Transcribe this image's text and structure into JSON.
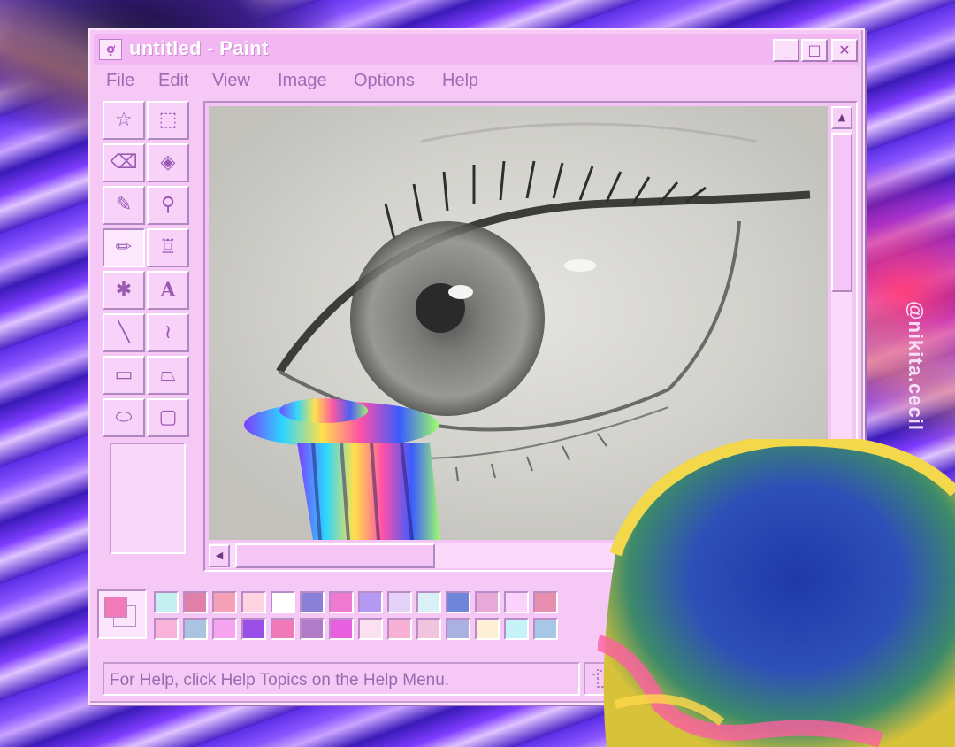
{
  "window": {
    "title": "untitled - Paint",
    "app_icon_glyph": "ợ",
    "controls": {
      "minimize": "_",
      "maximize": "□",
      "close": "✕"
    }
  },
  "menu": {
    "items": [
      {
        "label": "File"
      },
      {
        "label": "Edit"
      },
      {
        "label": "View"
      },
      {
        "label": "Image"
      },
      {
        "label": "Options"
      },
      {
        "label": "Help"
      }
    ]
  },
  "tools": [
    {
      "name": "free-form-select-icon",
      "glyph": "☆"
    },
    {
      "name": "rect-select-icon",
      "glyph": "⬚"
    },
    {
      "name": "eraser-icon",
      "glyph": "⌫"
    },
    {
      "name": "fill-bucket-icon",
      "glyph": "◈"
    },
    {
      "name": "color-picker-icon",
      "glyph": "✎"
    },
    {
      "name": "magnifier-icon",
      "glyph": "⚲"
    },
    {
      "name": "pencil-icon",
      "glyph": "✏"
    },
    {
      "name": "brush-icon",
      "glyph": "♖"
    },
    {
      "name": "airbrush-icon",
      "glyph": "✱"
    },
    {
      "name": "text-icon",
      "glyph": "A"
    },
    {
      "name": "line-icon",
      "glyph": "╲"
    },
    {
      "name": "curve-icon",
      "glyph": "≀"
    },
    {
      "name": "rectangle-icon",
      "glyph": "▭"
    },
    {
      "name": "polygon-icon",
      "glyph": "⏢"
    },
    {
      "name": "ellipse-icon",
      "glyph": "⬭"
    },
    {
      "name": "rounded-rect-icon",
      "glyph": "▢"
    }
  ],
  "active_tool": "pencil-icon",
  "scrollbar": {
    "up": "▲",
    "left": "◀"
  },
  "palette": {
    "foreground": "#f27ab8",
    "background": "#fbe6fb",
    "row1": [
      "#c4f0f0",
      "#e07fa8",
      "#f6a0b8",
      "#ffd4e0",
      "#ffffff",
      "#8a80d8",
      "#f07ad0",
      "#b49af2",
      "#e4d2f8",
      "#d8f0f6",
      "#6f86d8",
      "#e8a8d8",
      "#fbd2fb",
      "#e88fb0"
    ],
    "row2": [
      "#f8b4d8",
      "#a8c4e0",
      "#f6a4f0",
      "#9a50e8",
      "#f07ab8",
      "#b07cc8",
      "#e860e0",
      "#fbe0ef",
      "#f8b0d4",
      "#f0c4dc",
      "#aab0e0",
      "#fdf0d4",
      "#c4f4f8",
      "#a6c8e6"
    ]
  },
  "status": {
    "text": "For Help, click Help Topics on the Help Menu."
  },
  "watermark": "@nikita.cecil"
}
